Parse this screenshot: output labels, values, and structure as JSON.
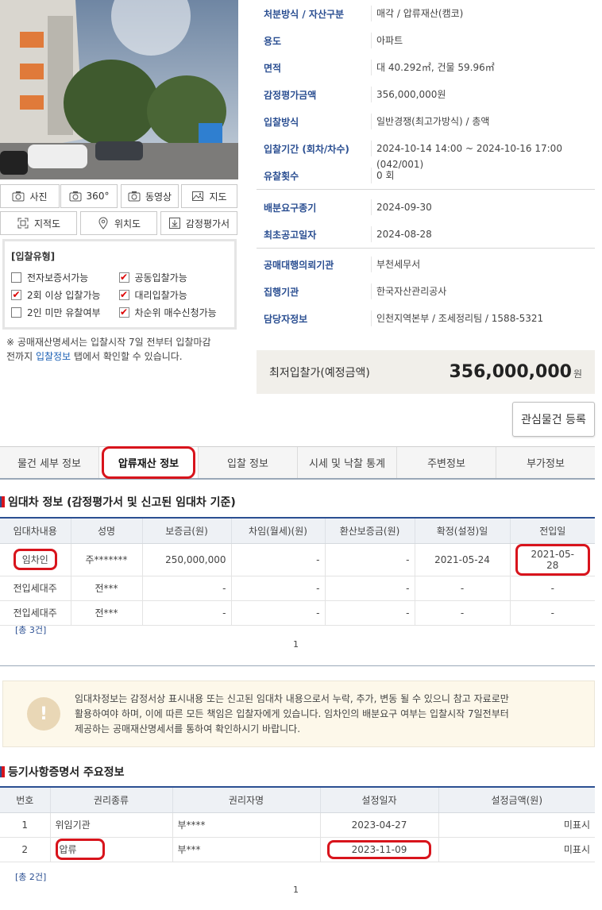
{
  "media_buttons": {
    "photo": "사진",
    "view360": "360°",
    "video": "동영상",
    "map": "지도",
    "cadastral": "지적도",
    "location": "위치도",
    "appraisal": "감정평가서"
  },
  "bid_types": {
    "title": "[입찰유형]",
    "items": [
      {
        "label": "전자보증서가능",
        "checked": false
      },
      {
        "label": "공동입찰가능",
        "checked": true
      },
      {
        "label": "2회 이상 입찰가능",
        "checked": true
      },
      {
        "label": "대리입찰가능",
        "checked": true
      },
      {
        "label": "2인 미만 유찰여부",
        "checked": false
      },
      {
        "label": "차순위 매수신청가능",
        "checked": true
      }
    ]
  },
  "notice": {
    "line1": "※ 공매재산명세서는 입찰시작 7일 전부터 입찰마감",
    "line2_pre": "전까지 ",
    "line2_link": "입찰정보",
    "line2_post": " 탭에서 확인할 수 있습니다."
  },
  "info": {
    "rows_a": [
      {
        "k": "처분방식 / 자산구분",
        "v": "매각 / 압류재산(캠코)"
      },
      {
        "k": "용도",
        "v": "아파트"
      },
      {
        "k": "면적",
        "v": "대 40.292㎡, 건물 59.96㎡"
      },
      {
        "k": "감정평가금액",
        "v": "356,000,000원"
      },
      {
        "k": "입찰방식",
        "v": "일반경쟁(최고가방식) / 총액"
      },
      {
        "k": "입찰기간 (회차/차수)",
        "v": "2024-10-14 14:00 ~ 2024-10-16 17:00 (042/001)"
      },
      {
        "k": "유찰횟수",
        "v": "0 회"
      }
    ],
    "rows_b": [
      {
        "k": "배분요구종기",
        "v": "2024-09-30"
      },
      {
        "k": "최초공고일자",
        "v": "2024-08-28"
      }
    ],
    "rows_c": [
      {
        "k": "공매대행의뢰기관",
        "v": "부천세무서"
      },
      {
        "k": "집행기관",
        "v": "한국자산관리공사"
      },
      {
        "k": "담당자정보",
        "v": "인천지역본부 / 조세정리팀 / 1588-5321"
      }
    ]
  },
  "min_bid": {
    "label": "최저입찰가(예정금액)",
    "amount": "356,000,000",
    "unit": "원"
  },
  "favorite_button": "관심물건 등록",
  "tabs": [
    "물건 세부 정보",
    "압류재산 정보",
    "입찰 정보",
    "시세 및 낙찰 통계",
    "주변정보",
    "부가정보"
  ],
  "tenant": {
    "title": "임대차 정보 (감정평가서 및 신고된 임대차 기준)",
    "headers": [
      "임대차내용",
      "성명",
      "보증금(원)",
      "차임(월세)(원)",
      "환산보증금(원)",
      "확정(설정)일",
      "전입일"
    ],
    "rows": [
      [
        "임차인",
        "주*******",
        "250,000,000",
        "-",
        "-",
        "2021-05-24",
        "2021-05-28"
      ],
      [
        "전입세대주",
        "전***",
        "-",
        "-",
        "-",
        "-",
        "-"
      ],
      [
        "전입세대주",
        "전***",
        "-",
        "-",
        "-",
        "-",
        "-"
      ]
    ],
    "count": "[총 3건]",
    "page": "1"
  },
  "warning": {
    "line1": "임대차정보는 감정서상 표시내용 또는 신고된 임대차 내용으로서 누락, 추가, 변동 될 수 있으니 참고 자료로만",
    "line2": "활용하여야 하며, 이에 따른 모든 책임은 입찰자에게 있습니다. 임차인의 배분요구 여부는 입찰시작 7일전부터",
    "line3": "제공하는 공매재산명세서를 통하여 확인하시기 바랍니다."
  },
  "registry": {
    "title": "등기사항증명서 주요정보",
    "headers": [
      "번호",
      "권리종류",
      "권리자명",
      "설정일자",
      "설정금액(원)"
    ],
    "rows": [
      [
        "1",
        "위임기관",
        "부****",
        "2023-04-27",
        "미표시"
      ],
      [
        "2",
        "압류",
        "부***",
        "2023-11-09",
        "미표시"
      ]
    ],
    "count": "[총 2건]",
    "page": "1"
  }
}
